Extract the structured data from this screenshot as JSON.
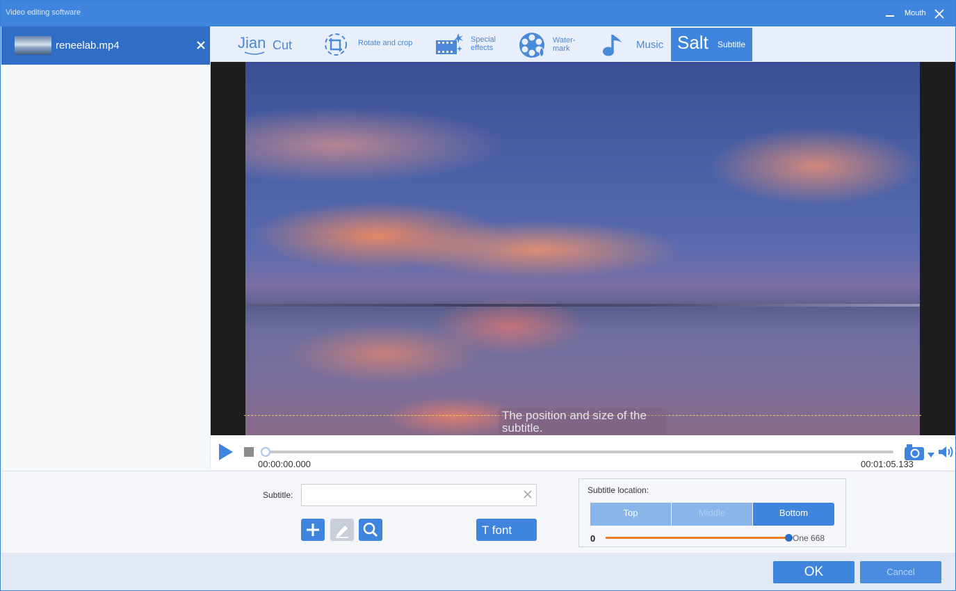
{
  "window": {
    "title": "Video editing software",
    "mouth_label": "Mouth"
  },
  "file": {
    "name": "reneelab.mp4"
  },
  "toolbar": {
    "cut": {
      "big": "Jian",
      "small": "Cut"
    },
    "rotate": {
      "label": "Rotate and crop"
    },
    "effects": {
      "line1": "Special",
      "line2": "effects"
    },
    "watermark": {
      "line1": "Water-",
      "line2": "mark"
    },
    "music": {
      "label": "Music"
    },
    "subtitle": {
      "big": "Salt",
      "small": "Subtitle"
    }
  },
  "preview": {
    "subtitle_placeholder": "The position and size of the subtitle."
  },
  "player": {
    "time_start": "00:00:00.000",
    "time_end": "00:01:05.133",
    "progress": 0
  },
  "subtitle_editor": {
    "label": "Subtitle:",
    "input_value": "",
    "font_button": "T font"
  },
  "location": {
    "title": "Subtitle location:",
    "options": [
      "Top",
      "Middle",
      "Bottom"
    ],
    "selected": "Bottom",
    "slider_min": "0",
    "slider_max": "One 668",
    "slider_value": 668
  },
  "footer": {
    "ok": "OK",
    "cancel": "Cancel"
  },
  "colors": {
    "accent": "#3f85dd",
    "slider": "#f07b26"
  }
}
